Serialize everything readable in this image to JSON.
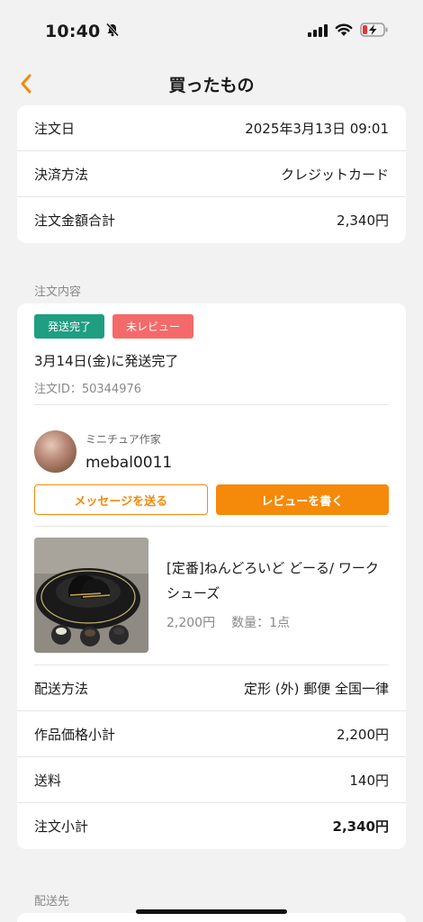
{
  "status_bar": {
    "time": "10:40"
  },
  "nav": {
    "title": "買ったもの"
  },
  "summary": {
    "rows": [
      {
        "label": "注文日",
        "value": "2025年3月13日 09:01"
      },
      {
        "label": "決済方法",
        "value": "クレジットカード"
      },
      {
        "label": "注文金額合計",
        "value": "2,340円"
      }
    ]
  },
  "order": {
    "section_label": "注文内容",
    "badges": {
      "shipped": "発送完了",
      "review": "未レビュー"
    },
    "status_text": "3月14日(金)に発送完了",
    "order_id": "注文ID：50344976",
    "seller": {
      "role": "ミニチュア作家",
      "name": "mebal0011"
    },
    "buttons": {
      "message": "メッセージを送る",
      "review": "レビューを書く"
    },
    "product": {
      "title": "[定番]ねんどろいど どーる/ ワークシューズ",
      "price": "2,200円",
      "quantity": "数量：1点"
    },
    "rows": [
      {
        "label": "配送方法",
        "value": "定形 (外) 郵便 全国一律"
      },
      {
        "label": "作品価格小計",
        "value": "2,200円"
      },
      {
        "label": "送料",
        "value": "140円"
      },
      {
        "label": "注文小計",
        "value": "2,340円"
      }
    ]
  },
  "shipping": {
    "section_label": "配送先"
  },
  "colors": {
    "accent": "#f5890a",
    "shipped": "#1f9e82",
    "review": "#f46a6a"
  }
}
